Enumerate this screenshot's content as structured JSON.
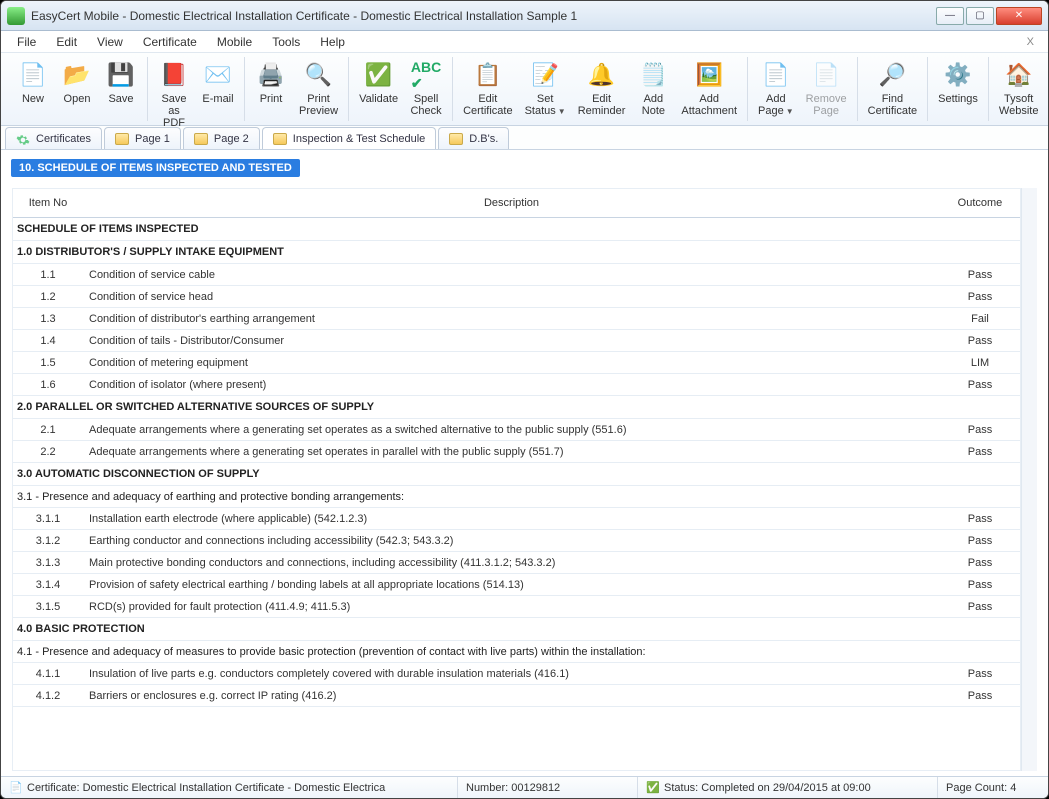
{
  "window": {
    "title": "EasyCert Mobile - Domestic Electrical Installation Certificate - Domestic Electrical Installation Sample 1"
  },
  "menubar": {
    "file": "File",
    "edit": "Edit",
    "view": "View",
    "certificate": "Certificate",
    "mobile": "Mobile",
    "tools": "Tools",
    "help": "Help",
    "close_x": "X"
  },
  "toolbar": {
    "new": "New",
    "open": "Open",
    "save": "Save",
    "save_as_pdf_l1": "Save",
    "save_as_pdf_l2": "as PDF",
    "email": "E-mail",
    "print": "Print",
    "print_preview_l1": "Print",
    "print_preview_l2": "Preview",
    "validate": "Validate",
    "spell_l1": "Spell",
    "spell_l2": "Check",
    "edit_cert_l1": "Edit",
    "edit_cert_l2": "Certificate",
    "set_status_l1": "Set",
    "set_status_l2": "Status",
    "edit_rem_l1": "Edit",
    "edit_rem_l2": "Reminder",
    "add_note_l1": "Add",
    "add_note_l2": "Note",
    "add_att_l1": "Add",
    "add_att_l2": "Attachment",
    "add_page_l1": "Add",
    "add_page_l2": "Page",
    "remove_page_l1": "Remove",
    "remove_page_l2": "Page",
    "find_cert_l1": "Find",
    "find_cert_l2": "Certificate",
    "settings": "Settings",
    "tysoft_l1": "Tysoft",
    "tysoft_l2": "Website"
  },
  "tabs": {
    "certificates": "Certificates",
    "page1": "Page 1",
    "page2": "Page 2",
    "inspection": "Inspection & Test Schedule",
    "dbs": "D.B's."
  },
  "section": {
    "heading": "10.  SCHEDULE OF ITEMS INSPECTED AND TESTED"
  },
  "table": {
    "headers": {
      "item": "Item No",
      "desc": "Description",
      "outcome": "Outcome"
    },
    "group_inspected": "SCHEDULE OF ITEMS INSPECTED",
    "g1": "1.0 DISTRIBUTOR'S / SUPPLY INTAKE EQUIPMENT",
    "r1_1_no": "1.1",
    "r1_1_desc": "Condition of service cable",
    "r1_1_out": "Pass",
    "r1_2_no": "1.2",
    "r1_2_desc": "Condition of service head",
    "r1_2_out": "Pass",
    "r1_3_no": "1.3",
    "r1_3_desc": "Condition of distributor's earthing arrangement",
    "r1_3_out": "Fail",
    "r1_4_no": "1.4",
    "r1_4_desc": "Condition of tails - Distributor/Consumer",
    "r1_4_out": "Pass",
    "r1_5_no": "1.5",
    "r1_5_desc": "Condition of metering equipment",
    "r1_5_out": "LIM",
    "r1_6_no": "1.6",
    "r1_6_desc": "Condition of isolator (where present)",
    "r1_6_out": "Pass",
    "g2": "2.0 PARALLEL OR SWITCHED ALTERNATIVE SOURCES OF SUPPLY",
    "r2_1_no": "2.1",
    "r2_1_desc": "Adequate arrangements where a generating set operates as a switched alternative to the public supply (551.6)",
    "r2_1_out": "Pass",
    "r2_2_no": "2.2",
    "r2_2_desc": "Adequate arrangements where a generating set operates in parallel with the public supply (551.7)",
    "r2_2_out": "Pass",
    "g3": "3.0 AUTOMATIC DISCONNECTION OF SUPPLY",
    "s3_1": "3.1 - Presence and adequacy of earthing and protective bonding arrangements:",
    "r3_1_1_no": "3.1.1",
    "r3_1_1_desc": "Installation earth electrode (where applicable) (542.1.2.3)",
    "r3_1_1_out": "Pass",
    "r3_1_2_no": "3.1.2",
    "r3_1_2_desc": "Earthing conductor and connections including accessibility (542.3; 543.3.2)",
    "r3_1_2_out": "Pass",
    "r3_1_3_no": "3.1.3",
    "r3_1_3_desc": "Main protective bonding conductors and connections, including accessibility (411.3.1.2; 543.3.2)",
    "r3_1_3_out": "Pass",
    "r3_1_4_no": "3.1.4",
    "r3_1_4_desc": "Provision of safety electrical earthing / bonding labels at all appropriate locations (514.13)",
    "r3_1_4_out": "Pass",
    "r3_1_5_no": "3.1.5",
    "r3_1_5_desc": "RCD(s) provided for fault protection (411.4.9; 411.5.3)",
    "r3_1_5_out": "Pass",
    "g4": "4.0 BASIC PROTECTION",
    "s4_1": "4.1 - Presence and adequacy of measures to provide basic protection (prevention of contact with live parts) within the installation:",
    "r4_1_1_no": "4.1.1",
    "r4_1_1_desc": "Insulation of live parts e.g. conductors completely covered with durable insulation materials (416.1)",
    "r4_1_1_out": "Pass",
    "r4_1_2_no": "4.1.2",
    "r4_1_2_desc": "Barriers or enclosures e.g. correct IP rating (416.2)",
    "r4_1_2_out": "Pass"
  },
  "status": {
    "cert_label": "Certificate: Domestic Electrical Installation Certificate - Domestic Electrica",
    "number": "Number: 00129812",
    "status_text": "Status: Completed on 29/04/2015 at 09:00",
    "page_count": "Page Count: 4"
  }
}
